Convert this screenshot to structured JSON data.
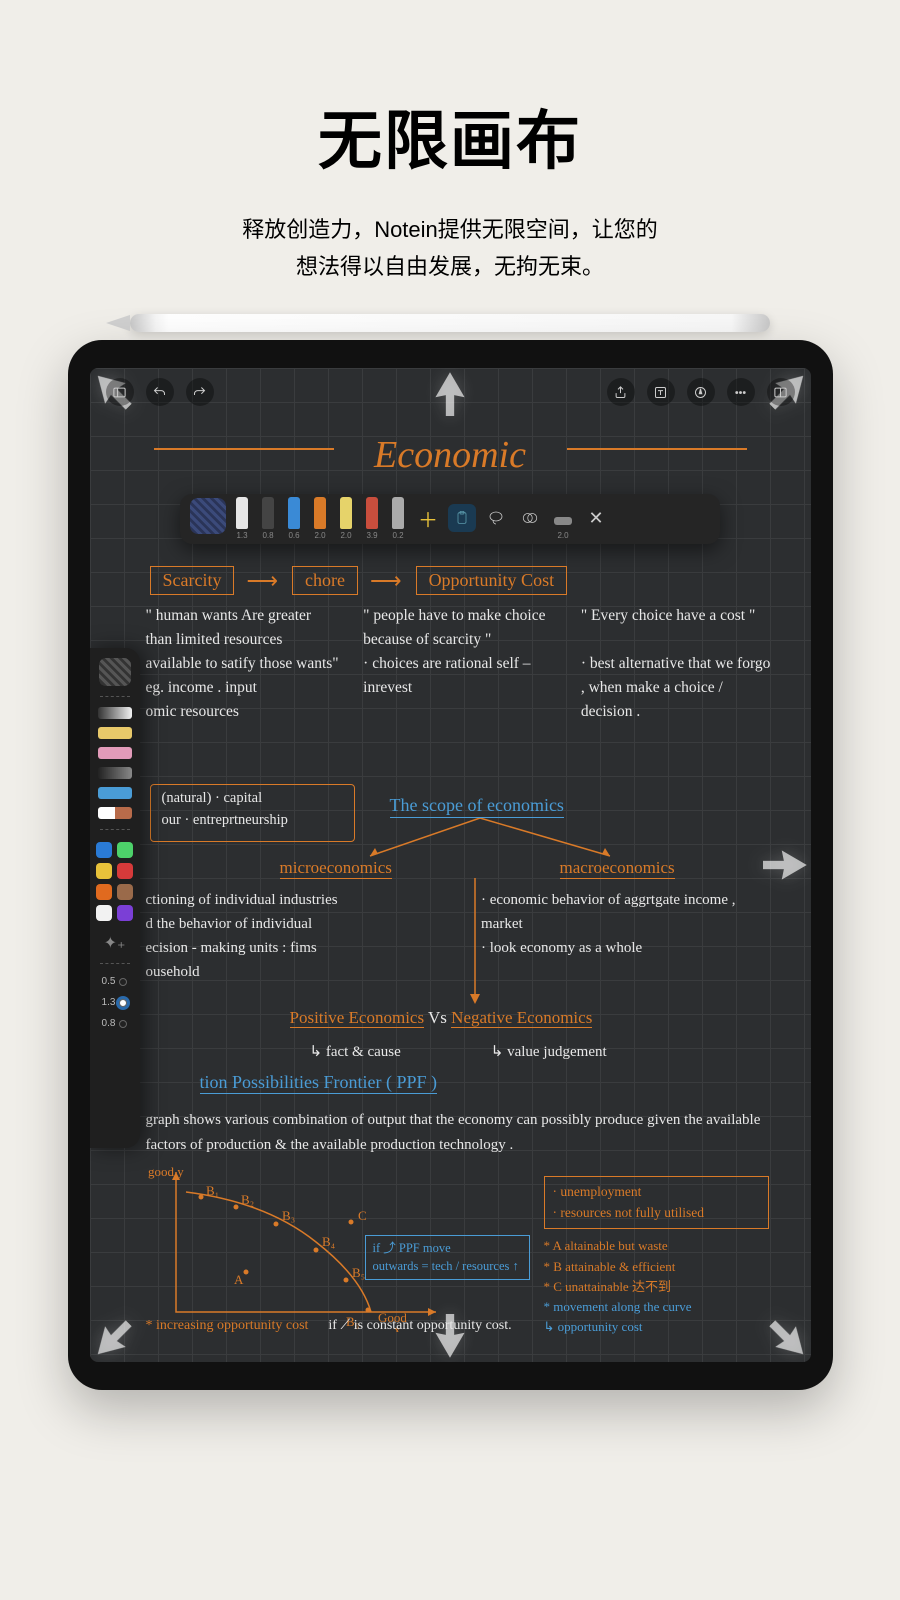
{
  "hero": {
    "title": "无限画布",
    "sub1": "释放创造力，Notein提供无限空间，让您的",
    "sub2": "想法得以自由发展，无拘无束。"
  },
  "topbar": {
    "sidebar": "sidebar",
    "undo": "undo",
    "redo": "redo",
    "share": "share",
    "text": "text",
    "pen": "pen-style",
    "more": "more",
    "split": "split"
  },
  "pen_tray": {
    "sizes": [
      "1.3",
      "0.8",
      "0.6",
      "2.0",
      "2.0",
      "3.9",
      "0.2",
      "2.0"
    ],
    "pen_colors": [
      "#e6e6e6",
      "#222",
      "#3a8ad6",
      "#d97a28",
      "#e6d36a",
      "#c94e3d",
      "#8a8a8a"
    ]
  },
  "note": {
    "title": "Economic",
    "k1": "Scarcity",
    "k2": "chore",
    "k3": "Opportunity  Cost",
    "c1": "\" human wants Are greater than limited resources available to satify those wants\"\neg. income . input\nomic resources",
    "c2": "\" people have to make choice because  of scarcity \"\n· choices  are rational self – inrevest",
    "c3": "\" Every choice  have a cost \"\n\n· best alternative that we forgo , when  make a choice / decision .",
    "nat": "(natural) · capital\nour  · entreprtneurship",
    "scope": "The  scope  of  economics",
    "micro": "microeconomics",
    "macro": "macroeconomics",
    "m1": "ctioning of  individual   industries\nd   the  behavior  of   individual\necision - making  units  :  fims\nousehold",
    "m2": "· economic  behavior  of aggrtgate  income , market\n· look  economy  as  a  whole",
    "pos": "Positive   Economics",
    "neg": "Negative  Economics",
    "vs": "  Vs  ",
    "fact": "↳ fact  &  cause",
    "valj": "↳  value  judgement",
    "ppf_head": "tion  Possibilities  Frontier  ( PPF )",
    "ppf_body": "graph  shows   various   combination  of  output   that   the  economy can  possibly  produce  given  the  available  factors  of  production  & the  available  production  technology .",
    "legend1": "· unemployment",
    "legend2": "· resources  not fully utilised",
    "la": "* A   altainable  but  waste",
    "lb": "* B   attainable   &  efficient",
    "lc": "* C   unattainable  达不到",
    "lmove": "* movement  along  the  curve",
    "lopp": "↳ opportunity  cost",
    "ppf_box1": "if   ⤴  PPF  move",
    "ppf_box2": "outwards = tech / resources ↑",
    "bottom1": "* increasing  opportunity  cost",
    "bottom2": "if  ⟋  is  constant  opportunity  cost.",
    "good_y": "good y",
    "good_x": "Good\nx"
  },
  "side": {
    "brush_colors": [
      "#f2f2f2",
      "#e8c96a",
      "#e29bb9",
      "#333",
      "#4a9cd6",
      "#b86b4a"
    ],
    "palette": [
      "#2a7bd6",
      "#4dd16a",
      "#e8c23a",
      "#d63a3a",
      "#e06a1f",
      "#9a6a4a",
      "#f2f2f2",
      "#7b3fd6"
    ],
    "s1": "0.5",
    "s2": "1.3",
    "s3": "0.8"
  }
}
